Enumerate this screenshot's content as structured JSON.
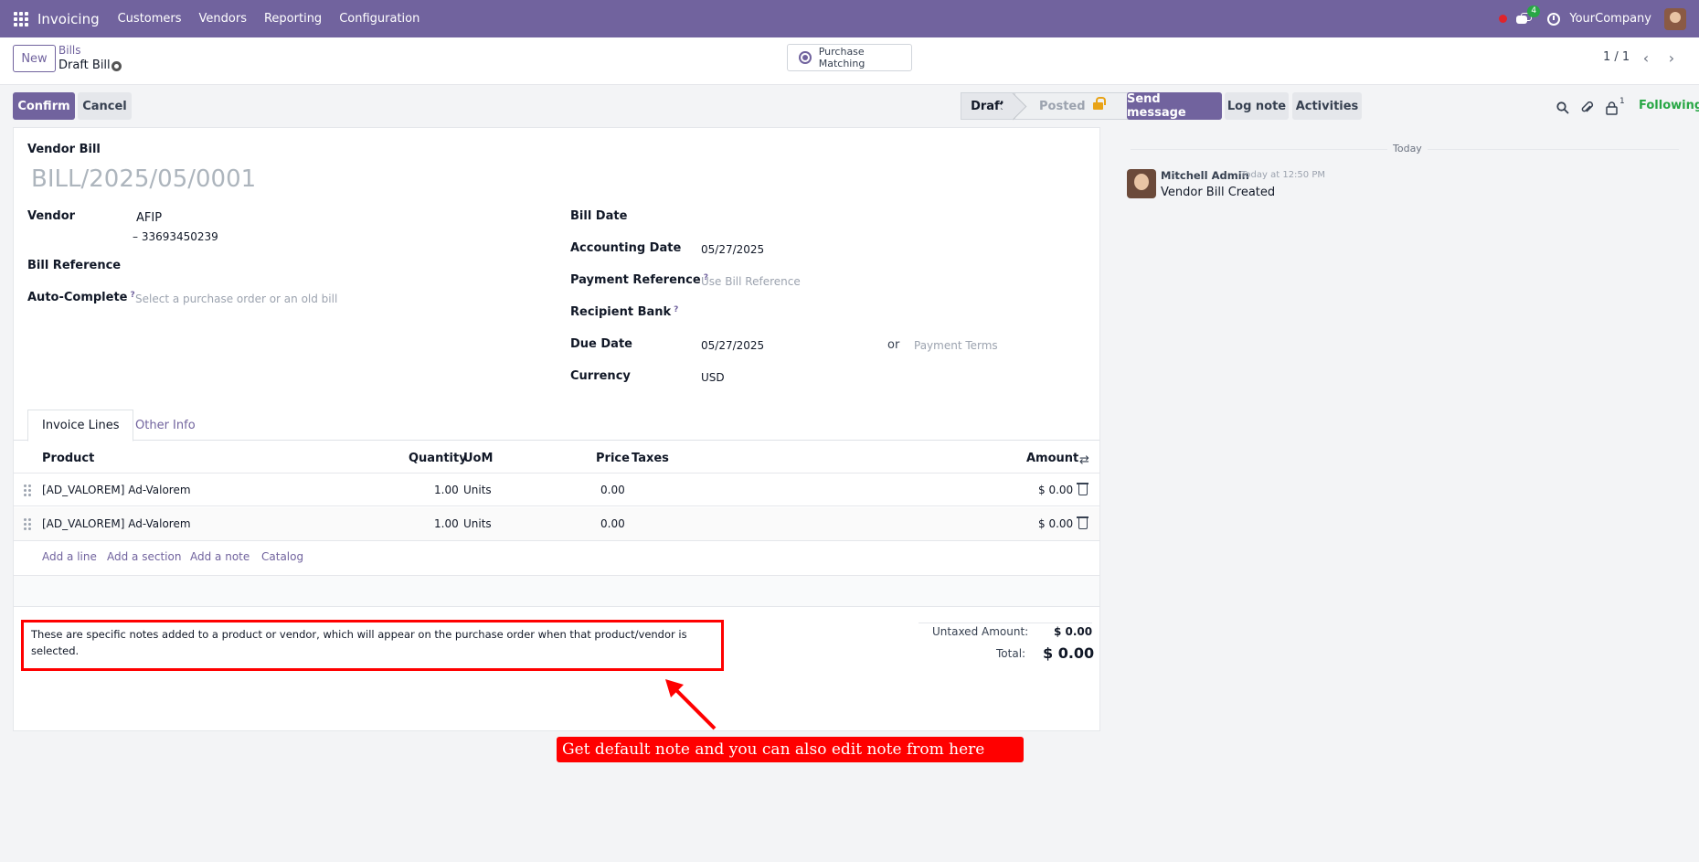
{
  "navbar": {
    "app_name": "Invoicing",
    "menu": [
      "Customers",
      "Vendors",
      "Reporting",
      "Configuration"
    ],
    "chat_count": "4",
    "company": "YourCompany"
  },
  "control": {
    "new_label": "New",
    "breadcrumb_parent": "Bills",
    "breadcrumb_current": "Draft Bill",
    "purchase_matching_label": "Purchase Matching",
    "pager": "1 / 1"
  },
  "actions": {
    "confirm": "Confirm",
    "cancel": "Cancel"
  },
  "status": {
    "draft": "Draft",
    "posted": "Posted"
  },
  "form": {
    "type_label": "Vendor Bill",
    "bill_name": "BILL/2025/05/0001",
    "vendor_label": "Vendor",
    "vendor_name": "AFIP",
    "vendor_vat": "– 33693450239",
    "bill_reference_label": "Bill Reference",
    "auto_complete_label": "Auto-Complete",
    "auto_complete_placeholder": "Select a purchase order or an old bill",
    "bill_date_label": "Bill Date",
    "accounting_date_label": "Accounting Date",
    "accounting_date": "05/27/2025",
    "payment_reference_label": "Payment Reference",
    "payment_reference_placeholder": "Use Bill Reference",
    "recipient_bank_label": "Recipient Bank",
    "due_date_label": "Due Date",
    "due_date": "05/27/2025",
    "or_text": "or",
    "payment_terms_placeholder": "Payment Terms",
    "currency_label": "Currency",
    "currency": "USD",
    "help_mark": "?"
  },
  "tabs": [
    "Invoice Lines",
    "Other Info"
  ],
  "lines": {
    "headers": {
      "product": "Product",
      "quantity": "Quantity",
      "uom": "UoM",
      "price": "Price",
      "taxes": "Taxes",
      "amount": "Amount"
    },
    "rows": [
      {
        "product": "[AD_VALOREM] Ad-Valorem",
        "quantity": "1.00",
        "uom": "Units",
        "price": "0.00",
        "amount": "$ 0.00"
      },
      {
        "product": "[AD_VALOREM] Ad-Valorem",
        "quantity": "1.00",
        "uom": "Units",
        "price": "0.00",
        "amount": "$ 0.00"
      }
    ],
    "add_links": [
      "Add a line",
      "Add a section",
      "Add a note",
      "Catalog"
    ]
  },
  "notes": "These are specific notes added to a product or vendor, which will appear on the purchase order when that product/vendor is selected.",
  "totals": {
    "untaxed_label": "Untaxed Amount:",
    "untaxed_value": "$ 0.00",
    "total_label": "Total:",
    "total_value": "$ 0.00"
  },
  "annotation": "Get default note and you can also edit note from here",
  "chatter": {
    "send_message": "Send message",
    "log_note": "Log note",
    "activities": "Activities",
    "follower_count": "1",
    "following": "Following",
    "today": "Today",
    "author": "Mitchell Admin",
    "time": "Today at 12:50 PM",
    "body": "Vendor Bill Created"
  },
  "colors": {
    "brand": "#71639e",
    "annotation": "#ff0000",
    "following": "#28a745"
  }
}
